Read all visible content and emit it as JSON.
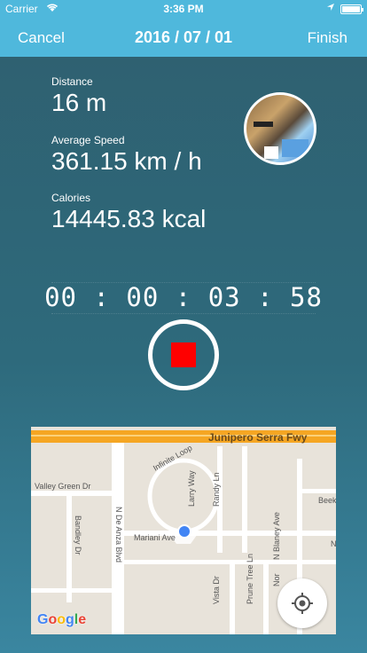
{
  "status_bar": {
    "carrier": "Carrier",
    "wifi_icon": "wifi-icon",
    "time": "3:36 PM",
    "location_icon": "location-arrow-icon",
    "battery_icon": "battery-icon"
  },
  "nav": {
    "cancel_label": "Cancel",
    "title": "2016 / 07 / 01",
    "finish_label": "Finish"
  },
  "stats": {
    "distance_label": "Distance",
    "distance_value": "16 m",
    "speed_label": "Average Speed",
    "speed_value": "361.15 km / h",
    "calories_label": "Calories",
    "calories_value": "14445.83 kcal"
  },
  "timer": "00:00:03:58",
  "stop_icon": "stop-icon",
  "map": {
    "streets": {
      "junipero": "Junipero Serra Fwy",
      "infinite_loop": "Infinite Loop",
      "valley_green": "Valley Green Dr",
      "bandley": "Bandley Dr",
      "de_anza": "N De Anza Blvd",
      "mariani": "Mariani Ave",
      "larry": "Larry Way",
      "randy": "Randy Ln",
      "beek": "Beek",
      "blaney": "N Blaney Ave",
      "vista": "Vista Dr",
      "prune_tree": "Prune Tree Ln",
      "nor": "Nor",
      "n_letter": "N"
    },
    "logo": "Google",
    "locate_icon": "crosshair-icon"
  },
  "colors": {
    "accent": "#4fb8dc",
    "stop": "#ff0000",
    "location_dot": "#4285f4"
  }
}
